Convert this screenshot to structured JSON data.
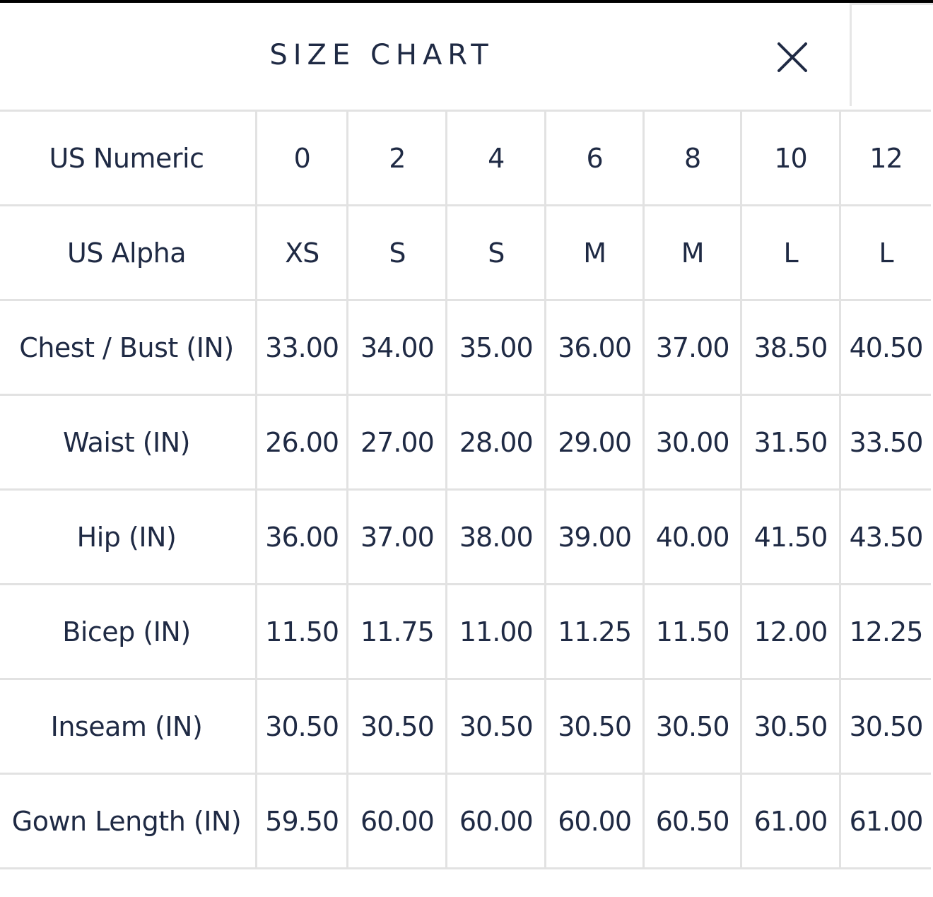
{
  "title": "SIZE CHART",
  "close_icon": "close-icon",
  "colors": {
    "text": "#1f2a44",
    "grid": "#e2e2e2",
    "background": "#ffffff"
  },
  "rows": [
    {
      "label": "US Numeric",
      "values": [
        "0",
        "2",
        "4",
        "6",
        "8",
        "10",
        "12"
      ]
    },
    {
      "label": "US Alpha",
      "values": [
        "XS",
        "S",
        "S",
        "M",
        "M",
        "L",
        "L"
      ]
    },
    {
      "label": "Chest / Bust (IN)",
      "values": [
        "33.00",
        "34.00",
        "35.00",
        "36.00",
        "37.00",
        "38.50",
        "40.50"
      ]
    },
    {
      "label": "Waist (IN)",
      "values": [
        "26.00",
        "27.00",
        "28.00",
        "29.00",
        "30.00",
        "31.50",
        "33.50"
      ]
    },
    {
      "label": "Hip (IN)",
      "values": [
        "36.00",
        "37.00",
        "38.00",
        "39.00",
        "40.00",
        "41.50",
        "43.50"
      ]
    },
    {
      "label": "Bicep (IN)",
      "values": [
        "11.50",
        "11.75",
        "11.00",
        "11.25",
        "11.50",
        "12.00",
        "12.25"
      ]
    },
    {
      "label": "Inseam (IN)",
      "values": [
        "30.50",
        "30.50",
        "30.50",
        "30.50",
        "30.50",
        "30.50",
        "30.50"
      ]
    },
    {
      "label": "Gown Length (IN)",
      "values": [
        "59.50",
        "60.00",
        "60.00",
        "60.00",
        "60.50",
        "61.00",
        "61.00"
      ]
    }
  ]
}
